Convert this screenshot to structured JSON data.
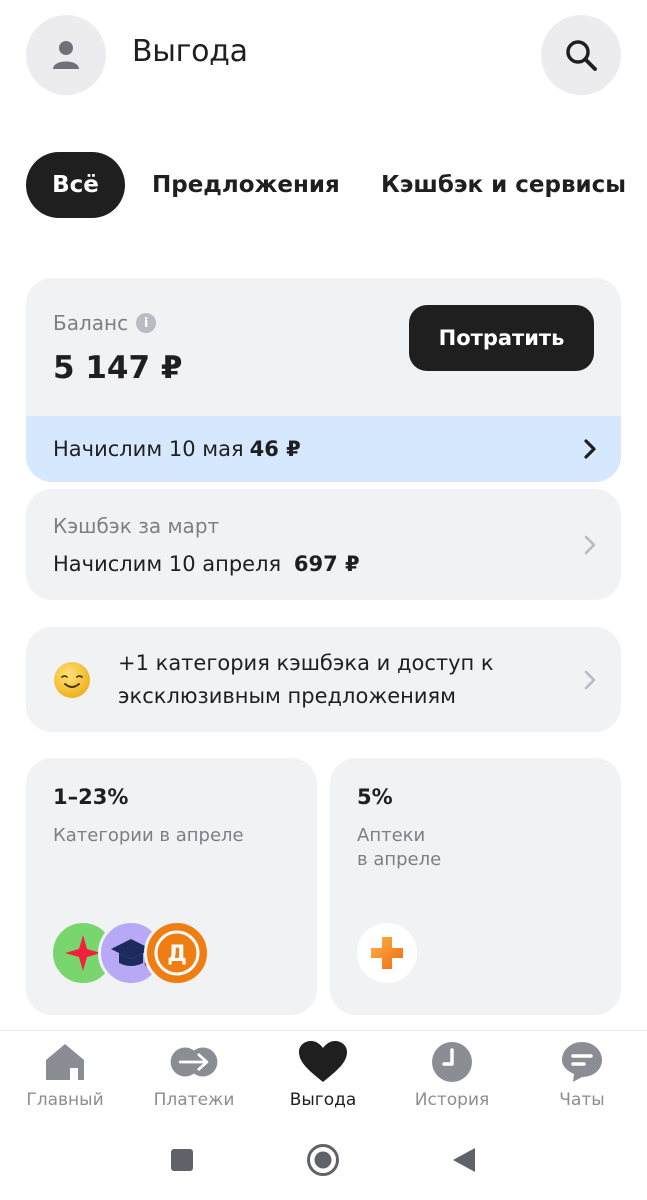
{
  "header": {
    "title": "Выгода",
    "avatar_icon": "user-icon",
    "search_icon": "search-icon"
  },
  "tabs": [
    {
      "label": "Всё",
      "active": true
    },
    {
      "label": "Предложения",
      "active": false
    },
    {
      "label": "Кэшбэк и сервисы",
      "active": false
    }
  ],
  "balance": {
    "label": "Баланс",
    "amount": "5 147 ₽",
    "spend_label": "Потратить",
    "accrual_text": "Начислим 10 мая",
    "accrual_amount": "46 ₽"
  },
  "cashback": {
    "title": "Кэшбэк за март",
    "accrual_text": "Начислим 10 апреля",
    "accrual_amount": "697 ₽"
  },
  "promo": {
    "text": "+1 категория кэшбэка и доступ к эксклюзивным предложениям"
  },
  "tiles": [
    {
      "value": "1–23%",
      "subtitle": "Категории в апреле"
    },
    {
      "value": "5%",
      "subtitle": "Аптеки\nв апреле"
    }
  ],
  "nav": [
    {
      "label": "Главный",
      "icon": "home-icon",
      "active": false
    },
    {
      "label": "Платежи",
      "icon": "payments-arrow-icon",
      "active": false
    },
    {
      "label": "Выгода",
      "icon": "heart-icon",
      "active": true
    },
    {
      "label": "История",
      "icon": "clock-icon",
      "active": false
    },
    {
      "label": "Чаты",
      "icon": "chat-icon",
      "active": false
    }
  ],
  "colors": {
    "accent_dark": "#1f1f1f",
    "card_bg": "#f1f2f4",
    "accrual_strip": "#d6e8fd",
    "muted_text": "#7c7f86"
  }
}
